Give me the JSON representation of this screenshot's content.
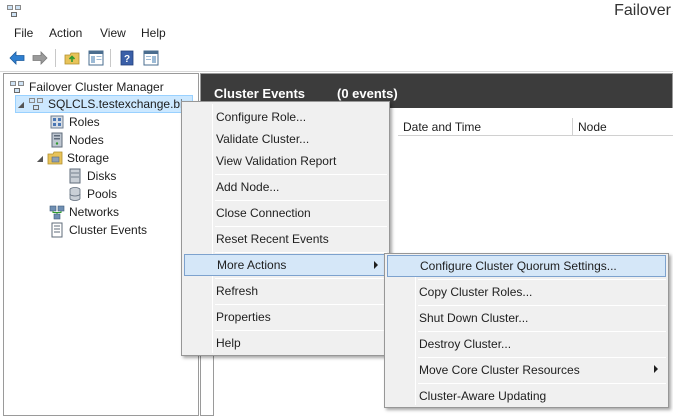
{
  "window": {
    "title": "Failover"
  },
  "menu": {
    "items": [
      "File",
      "Action",
      "View",
      "Help"
    ]
  },
  "toolbar": {
    "buttons": [
      "back-icon",
      "forward-icon",
      "up-folder-icon",
      "show-hide-tree-icon",
      "help-icon",
      "show-hide-action-pane-icon"
    ]
  },
  "tree": {
    "root": "Failover Cluster Manager",
    "cluster": "SQLCLS.testexchange.biz",
    "roles": "Roles",
    "nodes": "Nodes",
    "storage": "Storage",
    "disks": "Disks",
    "pools": "Pools",
    "networks": "Networks",
    "cluster_events": "Cluster Events"
  },
  "content": {
    "title": "Cluster Events",
    "count": "(0 events)",
    "columns": [
      "Date and Time",
      "Node"
    ]
  },
  "context_menu": {
    "configure_role": "Configure Role...",
    "validate_cluster": "Validate Cluster...",
    "view_validation_report": "View Validation Report",
    "add_node": "Add Node...",
    "close_connection": "Close Connection",
    "reset_recent_events": "Reset Recent Events",
    "more_actions": "More Actions",
    "refresh": "Refresh",
    "properties": "Properties",
    "help": "Help"
  },
  "submenu": {
    "configure_quorum": "Configure Cluster Quorum Settings...",
    "copy_roles": "Copy Cluster Roles...",
    "shut_down": "Shut Down Cluster...",
    "destroy": "Destroy Cluster...",
    "move_core": "Move Core Cluster Resources",
    "cau": "Cluster-Aware Updating"
  },
  "colors": {
    "header_bg": "#3c3c3c",
    "menu_bg": "#f0f0f0",
    "highlight_bg": "#d5e7f8",
    "highlight_border": "#7da2ce",
    "selection_bg": "#cce8ff"
  }
}
